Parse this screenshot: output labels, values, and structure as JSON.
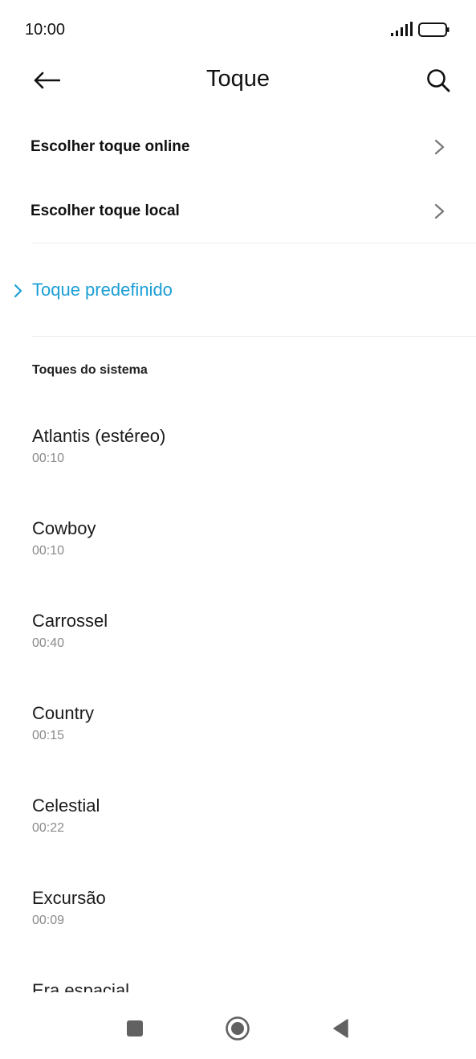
{
  "status_bar": {
    "time": "10:00",
    "icons": [
      "signal-icon",
      "battery-icon"
    ]
  },
  "app_bar": {
    "title": "Toque",
    "back_icon": "arrow-left-icon",
    "search_icon": "search-icon"
  },
  "menu": {
    "online_label": "Escolher toque online",
    "local_label": "Escolher toque local"
  },
  "default_ringtone": {
    "label": "Toque predefinido",
    "color": "#1c9fd6"
  },
  "system_section": {
    "header": "Toques do sistema",
    "items": [
      {
        "name": "Atlantis (estéreo)",
        "duration": "00:10"
      },
      {
        "name": "Cowboy",
        "duration": "00:10"
      },
      {
        "name": "Carrossel",
        "duration": "00:40"
      },
      {
        "name": "Country",
        "duration": "00:15"
      },
      {
        "name": "Celestial",
        "duration": "00:22"
      },
      {
        "name": "Excursão",
        "duration": "00:09"
      },
      {
        "name": "Era espacial",
        "duration": ""
      }
    ]
  },
  "navigation_bar": {
    "icons": [
      "recents-square-icon",
      "home-circle-icon",
      "back-triangle-icon"
    ]
  }
}
